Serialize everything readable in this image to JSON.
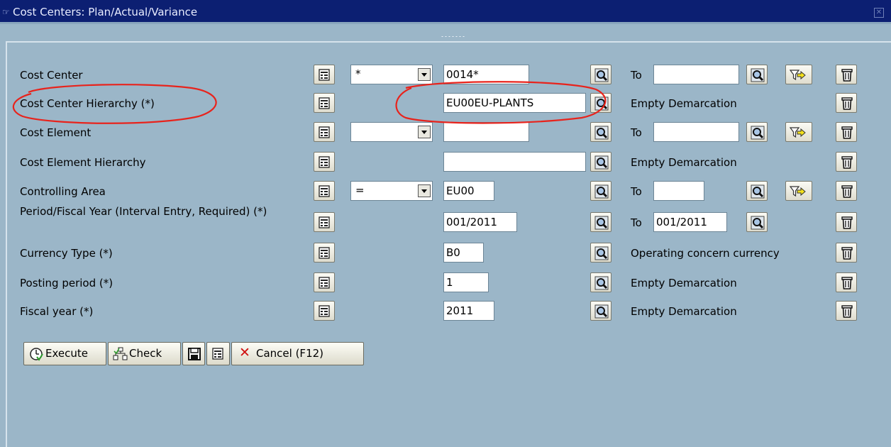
{
  "window": {
    "title": "Cost Centers: Plan/Actual/Variance"
  },
  "rows": [
    {
      "label": "Cost Center",
      "operator": "*",
      "from": "0014*",
      "to_label": "To",
      "to": ""
    },
    {
      "label": "Cost Center Hierarchy (*)",
      "from": "EU00EU-PLANTS",
      "right_text": "Empty Demarcation"
    },
    {
      "label": "Cost Element",
      "operator": "",
      "from": "",
      "to_label": "To",
      "to": ""
    },
    {
      "label": "Cost Element Hierarchy",
      "from": "",
      "right_text": "Empty Demarcation"
    },
    {
      "label": "Controlling Area",
      "operator": "=",
      "from": "EU00",
      "to_label": "To",
      "to": ""
    },
    {
      "label": "Period/Fiscal Year (Interval Entry, Required) (*)",
      "from": "001/2011",
      "to_label": "To",
      "to": "001/2011"
    },
    {
      "label": "Currency Type (*)",
      "from": "B0",
      "right_text": "Operating concern currency"
    },
    {
      "label": "Posting period (*)",
      "from": "1",
      "right_text": "Empty Demarcation"
    },
    {
      "label": "Fiscal year (*)",
      "from": "2011",
      "right_text": "Empty Demarcation"
    }
  ],
  "toolbar": {
    "execute": "Execute",
    "check": "Check",
    "cancel": "Cancel (F12)"
  },
  "icons": {
    "window": "window-icon",
    "options": "multiple-selection-icon",
    "search": "search-help-icon",
    "filter": "filter-arrow-icon",
    "delete": "trash-icon"
  },
  "colors": {
    "annotation": "#e8231c",
    "titlebar": "#0c1f72",
    "background": "#9bb6c8"
  }
}
